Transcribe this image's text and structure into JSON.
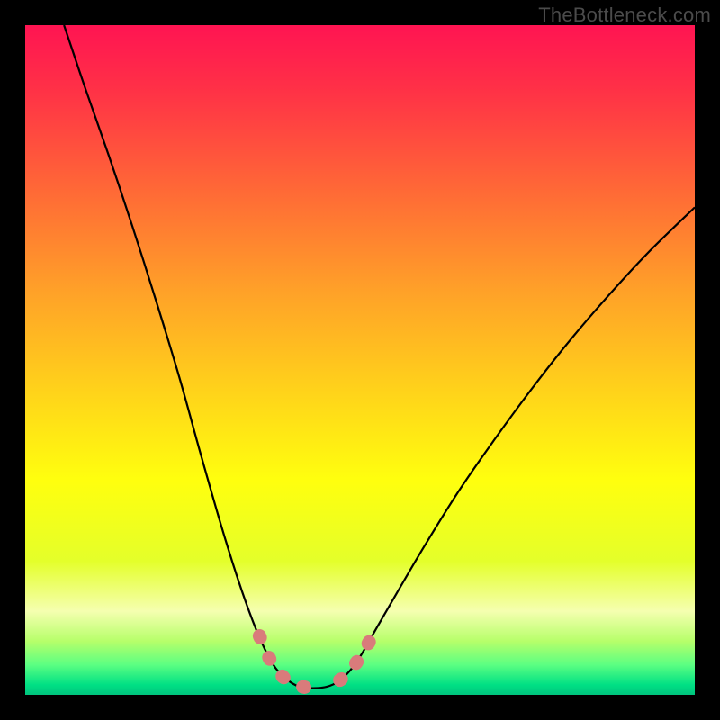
{
  "watermark": "TheBottleneck.com",
  "chart_data": {
    "type": "line",
    "title": "",
    "xlabel": "",
    "ylabel": "",
    "xlim": [
      0,
      1
    ],
    "ylim": [
      0,
      1
    ],
    "grid": false,
    "legend": false,
    "background": {
      "orientation": "vertical",
      "stops": [
        {
          "t": 0.0,
          "color": "#ff1452"
        },
        {
          "t": 0.1,
          "color": "#ff3246"
        },
        {
          "t": 0.25,
          "color": "#ff6a36"
        },
        {
          "t": 0.4,
          "color": "#ffa228"
        },
        {
          "t": 0.55,
          "color": "#ffd41a"
        },
        {
          "t": 0.68,
          "color": "#ffff0e"
        },
        {
          "t": 0.8,
          "color": "#e4ff2a"
        },
        {
          "t": 0.875,
          "color": "#f5ffb0"
        },
        {
          "t": 0.92,
          "color": "#b6ff6a"
        },
        {
          "t": 0.955,
          "color": "#5cff82"
        },
        {
          "t": 0.985,
          "color": "#00e084"
        },
        {
          "t": 1.0,
          "color": "#00c47e"
        }
      ]
    },
    "series": [
      {
        "name": "bottleneck-curve",
        "color": "#000000",
        "width": 2.2,
        "points": [
          {
            "x": 0.058,
            "y": 1.0
          },
          {
            "x": 0.09,
            "y": 0.905
          },
          {
            "x": 0.125,
            "y": 0.805
          },
          {
            "x": 0.16,
            "y": 0.7
          },
          {
            "x": 0.195,
            "y": 0.59
          },
          {
            "x": 0.23,
            "y": 0.475
          },
          {
            "x": 0.262,
            "y": 0.36
          },
          {
            "x": 0.293,
            "y": 0.252
          },
          {
            "x": 0.318,
            "y": 0.172
          },
          {
            "x": 0.34,
            "y": 0.11
          },
          {
            "x": 0.358,
            "y": 0.068
          },
          {
            "x": 0.374,
            "y": 0.04
          },
          {
            "x": 0.392,
            "y": 0.022
          },
          {
            "x": 0.41,
            "y": 0.012
          },
          {
            "x": 0.43,
            "y": 0.01
          },
          {
            "x": 0.45,
            "y": 0.012
          },
          {
            "x": 0.468,
            "y": 0.02
          },
          {
            "x": 0.485,
            "y": 0.036
          },
          {
            "x": 0.502,
            "y": 0.06
          },
          {
            "x": 0.525,
            "y": 0.1
          },
          {
            "x": 0.555,
            "y": 0.152
          },
          {
            "x": 0.598,
            "y": 0.225
          },
          {
            "x": 0.648,
            "y": 0.305
          },
          {
            "x": 0.7,
            "y": 0.38
          },
          {
            "x": 0.755,
            "y": 0.455
          },
          {
            "x": 0.81,
            "y": 0.525
          },
          {
            "x": 0.87,
            "y": 0.595
          },
          {
            "x": 0.93,
            "y": 0.66
          },
          {
            "x": 1.0,
            "y": 0.728
          }
        ]
      },
      {
        "name": "highlight-left",
        "color": "#d97b7b",
        "width": 15,
        "dash": [
          2,
          24
        ],
        "linecap": "round",
        "points": [
          {
            "x": 0.35,
            "y": 0.088
          },
          {
            "x": 0.36,
            "y": 0.064
          },
          {
            "x": 0.372,
            "y": 0.042
          },
          {
            "x": 0.386,
            "y": 0.026
          },
          {
            "x": 0.402,
            "y": 0.016
          },
          {
            "x": 0.42,
            "y": 0.011
          },
          {
            "x": 0.438,
            "y": 0.01
          }
        ]
      },
      {
        "name": "highlight-right",
        "color": "#d97b7b",
        "width": 15,
        "dash": [
          2,
          24
        ],
        "linecap": "round",
        "points": [
          {
            "x": 0.47,
            "y": 0.022
          },
          {
            "x": 0.48,
            "y": 0.03
          },
          {
            "x": 0.49,
            "y": 0.042
          },
          {
            "x": 0.5,
            "y": 0.056
          },
          {
            "x": 0.512,
            "y": 0.076
          },
          {
            "x": 0.526,
            "y": 0.102
          }
        ]
      }
    ]
  }
}
